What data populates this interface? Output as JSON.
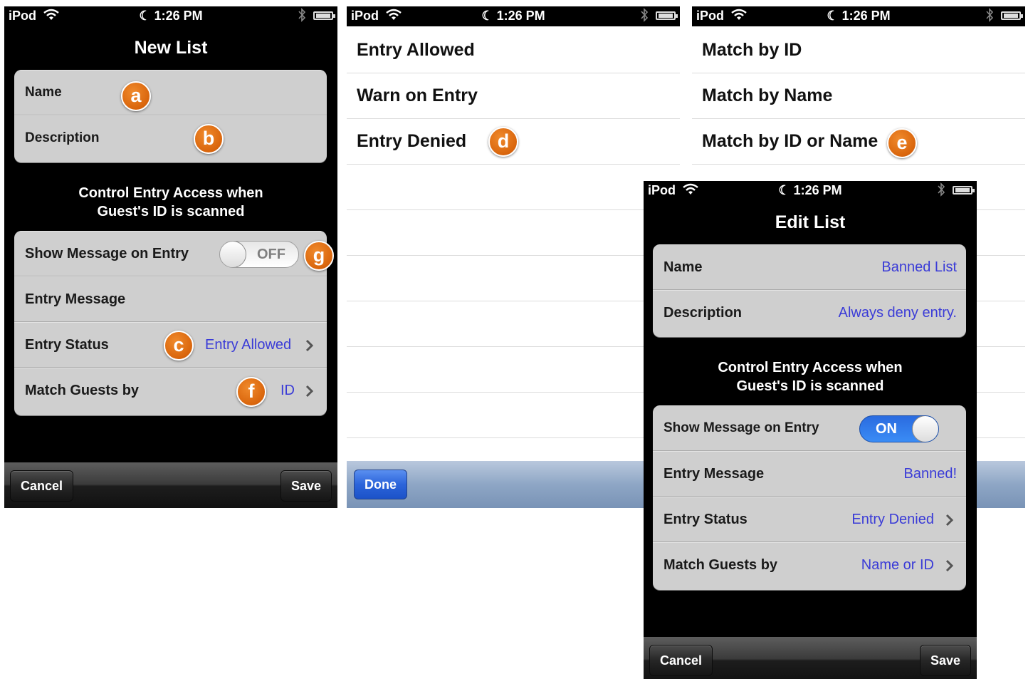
{
  "status_bar": {
    "carrier": "iPod",
    "time": "1:26 PM"
  },
  "new_list": {
    "title": "New List",
    "fields": {
      "name_label": "Name",
      "description_label": "Description"
    },
    "section_header_line1": "Control Entry Access when",
    "section_header_line2": "Guest's ID is scanned",
    "show_message": {
      "label": "Show Message on Entry",
      "state": "OFF"
    },
    "entry_message_label": "Entry Message",
    "entry_status": {
      "label": "Entry Status",
      "value": "Entry Allowed"
    },
    "match_guests": {
      "label": "Match Guests by",
      "value": "ID"
    },
    "cancel_label": "Cancel",
    "save_label": "Save"
  },
  "entry_status_picker": {
    "options": [
      "Entry Allowed",
      "Warn on Entry",
      "Entry Denied"
    ],
    "done_label": "Done"
  },
  "match_picker": {
    "options": [
      "Match by ID",
      "Match by Name",
      "Match by ID or Name"
    ]
  },
  "edit_list": {
    "title": "Edit List",
    "name": {
      "label": "Name",
      "value": "Banned List"
    },
    "description": {
      "label": "Description",
      "value": "Always deny entry."
    },
    "section_header_line1": "Control Entry Access when",
    "section_header_line2": "Guest's ID is scanned",
    "show_message": {
      "label": "Show Message on Entry",
      "state": "ON"
    },
    "entry_message": {
      "label": "Entry Message",
      "value": "Banned!"
    },
    "entry_status": {
      "label": "Entry Status",
      "value": "Entry Denied"
    },
    "match_guests": {
      "label": "Match Guests by",
      "value": "Name or ID"
    },
    "cancel_label": "Cancel",
    "save_label": "Save"
  },
  "callouts": {
    "a": "a",
    "b": "b",
    "c": "c",
    "d": "d",
    "e": "e",
    "f": "f",
    "g": "g"
  },
  "colors": {
    "value_blue": "#3a3bd7",
    "badge_orange": "#e0700f",
    "toggle_on_blue": "#2a6be0"
  }
}
